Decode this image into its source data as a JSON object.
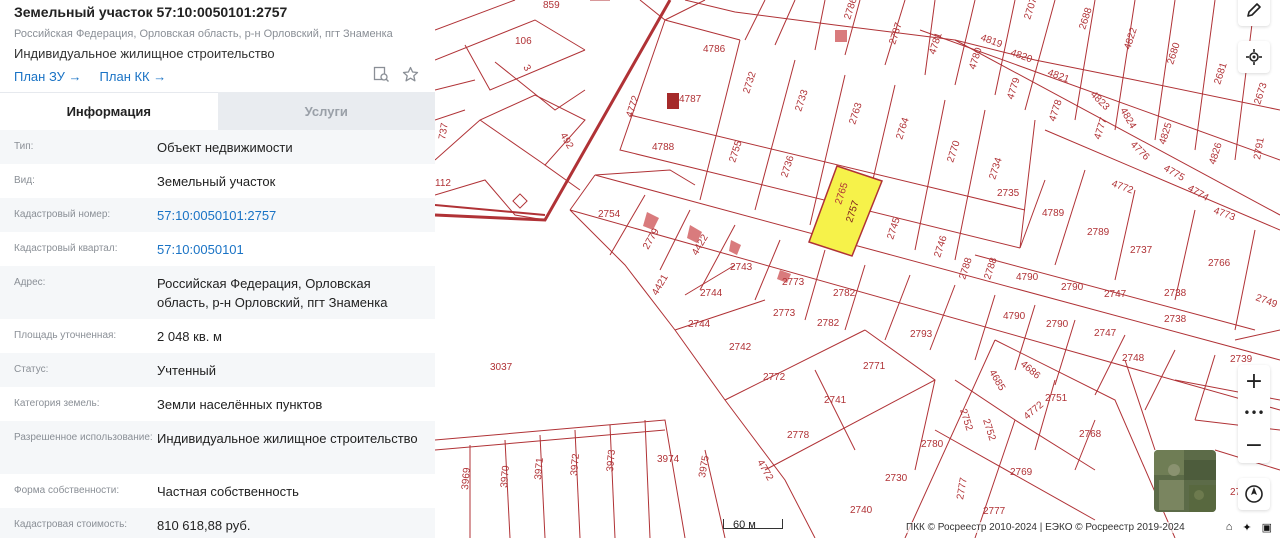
{
  "header": {
    "title": "Земельный участок 57:10:0050101:2757",
    "address": "Российская Федерация, Орловская область, р-н Орловский, пгт Знаменка",
    "use": "Индивидуальное жилищное строительство",
    "link_plan_zu": "План ЗУ →",
    "link_plan_kk": "План КК →"
  },
  "tabs": {
    "info": "Информация",
    "services": "Услуги"
  },
  "rows": [
    {
      "label": "Тип:",
      "value": "Объект недвижимости"
    },
    {
      "label": "Вид:",
      "value": "Земельный участок"
    },
    {
      "label": "Кадастровый номер:",
      "value": "57:10:0050101:2757"
    },
    {
      "label": "Кадастровый квартал:",
      "value": "57:10:0050101"
    },
    {
      "label": "Адрес:",
      "value": "Российская Федерация, Орловская область, р-н Орловский, пгт Знаменка"
    },
    {
      "label": "Площадь уточненная:",
      "value": "2 048 кв. м"
    },
    {
      "label": "Статус:",
      "value": "Учтенный"
    },
    {
      "label": "Категория земель:",
      "value": "Земли населённых пунктов"
    },
    {
      "label": "Разрешенное использование:",
      "value": "Индивидуальное жилищное строительство"
    },
    {
      "label": "Форма собственности:",
      "value": "Частная собственность"
    },
    {
      "label": "Кадастровая стоимость:",
      "value": "810 618,88 руб."
    }
  ],
  "map": {
    "plot_labels": [
      "859",
      "2786",
      "2707",
      "2688",
      "106",
      "4786",
      "4781",
      "4819",
      "4820",
      "4822",
      "4772",
      "2732",
      "2787",
      "4780",
      "2680",
      "2681",
      "2673",
      "4787",
      "2733",
      "4779",
      "4821",
      "4778",
      "4823",
      "4824",
      "4825",
      "4826",
      "2763",
      "2764",
      "4777",
      "4788",
      "2755",
      "2736",
      "2770",
      "2734",
      "4776",
      "4775",
      "4774",
      "4773",
      "2754",
      "2765",
      "2757",
      "2735",
      "4789",
      "2789",
      "2737",
      "2766",
      "2745",
      "2746",
      "2779",
      "4422",
      "2743",
      "2773",
      "2788",
      "4790",
      "2790",
      "2747",
      "2738",
      "4421",
      "2744",
      "2782",
      "2793",
      "2742",
      "2771",
      "2772",
      "2741",
      "2778",
      "2780",
      "2752",
      "4686",
      "2751",
      "2768",
      "2730",
      "2769",
      "2740",
      "2777",
      "2739",
      "2792",
      "3037",
      "3974",
      "3969",
      "3970",
      "3971",
      "3972",
      "3973",
      "3975",
      "4772",
      "492",
      "112",
      "3",
      "737",
      "4772",
      "2748",
      "2791"
    ],
    "scale_label": "60 м",
    "copyright": "ПКК © Росреестр 2010-2024 | ЕЭКО © Росреестр 2019-2024",
    "selected_plot": "2757"
  },
  "colors": {
    "accent": "#1a73c5",
    "boundary": "#b03236",
    "selected_fill": "#f6f24a",
    "building": "#d97b7d"
  }
}
